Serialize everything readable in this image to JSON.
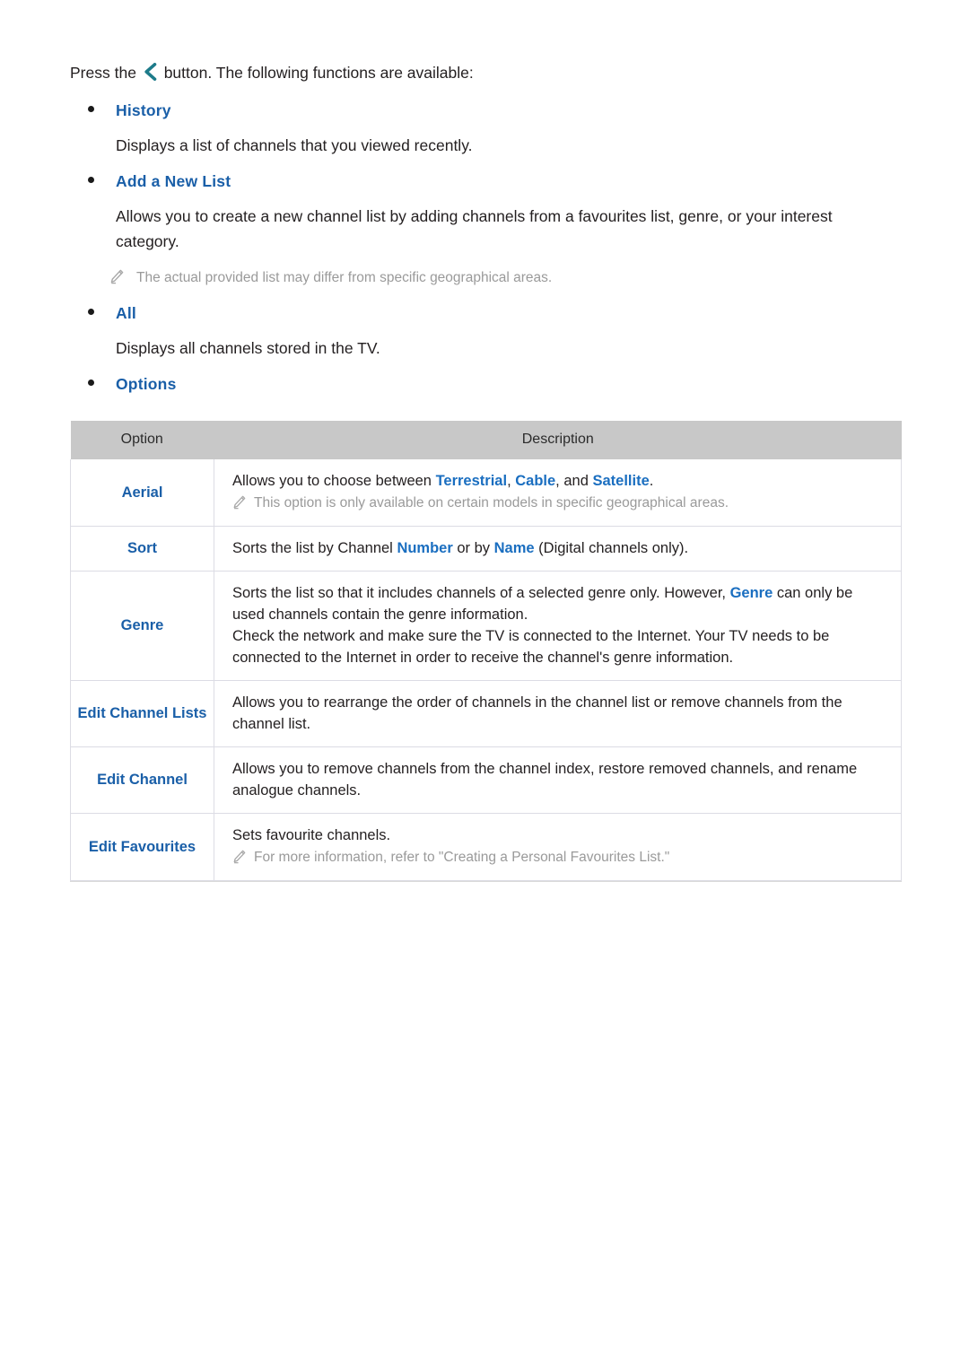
{
  "intro": {
    "before_icon": "Press the",
    "icon": "left-chevron-button-icon",
    "after_icon": "button. The following functions are available:"
  },
  "sections": [
    {
      "label": "History",
      "body": "Displays a list of channels that you viewed recently."
    },
    {
      "label": "Add a New List",
      "body": "Allows you to create a new channel list by adding channels from a favourites list, genre, or your interest category.",
      "note": "The actual provided list may differ from specific geographical areas."
    },
    {
      "label": "All",
      "body": "Displays all channels stored in the TV."
    },
    {
      "label": "Options"
    }
  ],
  "table": {
    "headers": {
      "option": "Option",
      "description": "Description"
    },
    "rows": [
      {
        "option": "Aerial",
        "desc_parts": [
          {
            "t": "Allows you to choose between "
          },
          {
            "t": "Terrestrial",
            "kw": true
          },
          {
            "t": ", "
          },
          {
            "t": "Cable",
            "kw": true
          },
          {
            "t": ", and "
          },
          {
            "t": "Satellite",
            "kw": true
          },
          {
            "t": "."
          }
        ],
        "note": "This option is only available on certain models in specific geographical areas."
      },
      {
        "option": "Sort",
        "desc_parts": [
          {
            "t": "Sorts the list by Channel "
          },
          {
            "t": "Number",
            "kw": true
          },
          {
            "t": " or by "
          },
          {
            "t": "Name",
            "kw": true
          },
          {
            "t": " (Digital channels only)."
          }
        ]
      },
      {
        "option": "Genre",
        "lines": [
          [
            {
              "t": "Sorts the list so that it includes channels of a selected genre only. However, "
            },
            {
              "t": "Genre",
              "kw": true
            },
            {
              "t": " can only be used channels contain the genre information."
            }
          ],
          [
            {
              "t": "Check the network and make sure the TV is connected to the Internet. Your TV needs to be connected to the Internet in order to receive the channel's genre information."
            }
          ]
        ]
      },
      {
        "option": "Edit Channel Lists",
        "desc_parts": [
          {
            "t": "Allows you to rearrange the order of channels in the channel list or remove channels from the channel list."
          }
        ]
      },
      {
        "option": "Edit Channel",
        "desc_parts": [
          {
            "t": "Allows you to remove channels from the channel index, restore removed channels, and rename analogue channels."
          }
        ]
      },
      {
        "option": "Edit Favourites",
        "desc_parts": [
          {
            "t": "Sets favourite channels."
          }
        ],
        "note": "For more information, refer to \"Creating a Personal Favourites List.\""
      }
    ]
  },
  "colors": {
    "link_blue": "#1a5fa8",
    "keyword_blue": "#1a6ec0",
    "chevron_teal": "#1d7b8a",
    "note_grey": "#9a9a9a",
    "table_header_grey": "#c8c8c8",
    "table_border": "#dcdce4"
  }
}
